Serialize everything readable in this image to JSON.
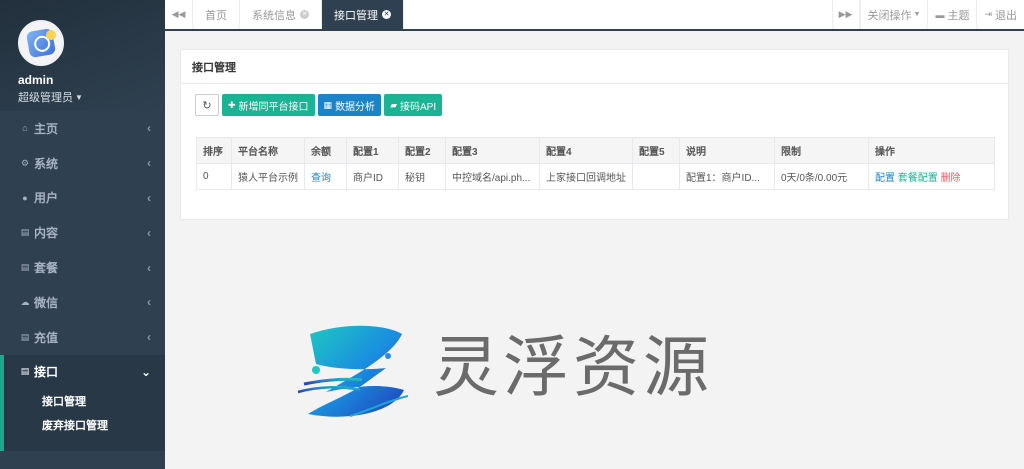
{
  "sidebar": {
    "user": {
      "name": "admin",
      "role": "超级管理员"
    },
    "items": [
      {
        "label": "主页",
        "icon": "home-icon"
      },
      {
        "label": "系统",
        "icon": "gears-icon"
      },
      {
        "label": "用户",
        "icon": "users-icon"
      },
      {
        "label": "内容",
        "icon": "file-icon"
      },
      {
        "label": "套餐",
        "icon": "file-text-icon"
      },
      {
        "label": "微信",
        "icon": "wechat-icon"
      },
      {
        "label": "充值",
        "icon": "file-icon"
      },
      {
        "label": "接口",
        "icon": "file-icon",
        "active": true
      }
    ],
    "subitems": [
      {
        "label": "接口管理"
      },
      {
        "label": "废弃接口管理"
      }
    ]
  },
  "topbar": {
    "tabs": [
      {
        "label": "首页"
      },
      {
        "label": "系统信息"
      },
      {
        "label": "接口管理",
        "active": true
      }
    ],
    "close_ops": "关闭操作",
    "theme": "主题",
    "logout": "退出"
  },
  "panel": {
    "title": "接口管理",
    "buttons": {
      "add": "新增同平台接口",
      "analysis": "数据分析",
      "api": "接码API"
    },
    "table": {
      "headers": [
        "排序",
        "平台名称",
        "余额",
        "配置1",
        "配置2",
        "配置3",
        "配置4",
        "配置5",
        "说明",
        "限制",
        "操作"
      ],
      "rows": [
        {
          "order": "0",
          "name": "猿人平台示例",
          "balance": "查询",
          "cfg1": "商户ID",
          "cfg2": "秘钥",
          "cfg3": "中控域名/api.ph...",
          "cfg4": "上家接口回调地址",
          "cfg5": "",
          "desc": "配置1：商户ID...",
          "limit": "0天/0条/0.00元",
          "ops": {
            "config": "配置",
            "package": "套餐配置",
            "delete": "删除"
          }
        }
      ]
    }
  },
  "watermark": {
    "text": "灵浮资源"
  },
  "colors": {
    "sidebar_bg": "#2f4050",
    "accent_green": "#1ab394",
    "accent_blue": "#1c84c6",
    "danger": "#ed5565"
  }
}
